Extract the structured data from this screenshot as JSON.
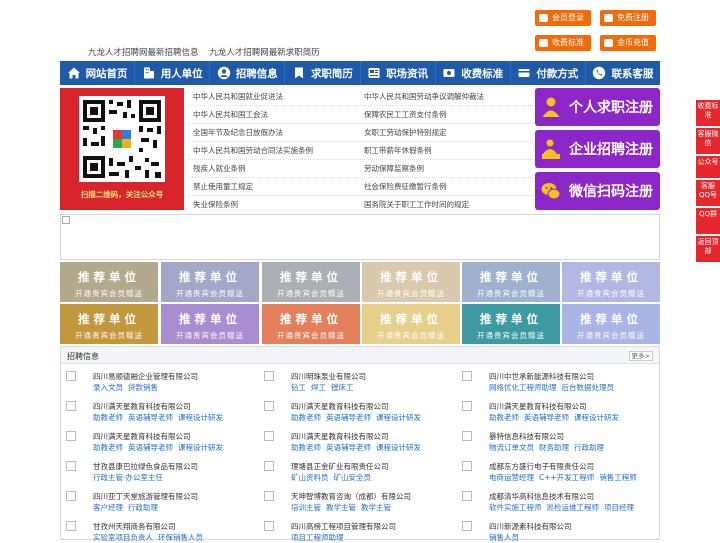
{
  "top_buttons": {
    "login": "会员登录",
    "register": "免费注册",
    "fees": "收费标准",
    "recharge": "金币充值"
  },
  "top_links": [
    "九龙人才招聘网最新招聘信息",
    "九龙人才招聘网最新求职简历"
  ],
  "nav": [
    {
      "label": "网站首页",
      "icon": "home-icon"
    },
    {
      "label": "用人单位",
      "icon": "building-icon"
    },
    {
      "label": "招聘信息",
      "icon": "user-icon"
    },
    {
      "label": "求职简历",
      "icon": "bookmark-icon"
    },
    {
      "label": "职场资讯",
      "icon": "news-icon"
    },
    {
      "label": "收费标准",
      "icon": "money-icon"
    },
    {
      "label": "付款方式",
      "icon": "card-icon"
    },
    {
      "label": "联系客服",
      "icon": "phone-icon"
    }
  ],
  "qr_caption": "扫描二维码，关注公众号",
  "laws_left": [
    "中华人民共和国就业促进法",
    "中华人民共和国工会法",
    "全国年节及纪念日放假办法",
    "中华人民共和国劳动合同法实施条例",
    "残疾人就业条例",
    "禁止使用童工规定",
    "失业保险条例"
  ],
  "laws_right": [
    "中华人民共和国劳动争议调解仲裁法",
    "保障农民工工资支付条例",
    "女职工劳动保护特别规定",
    "职工带薪年休假条例",
    "劳动保障监察条例",
    "社会保险费征缴暂行条例",
    "国务院关于职工工作时间的规定"
  ],
  "register_buttons": [
    "个人求职注册",
    "企业招聘注册",
    "微信扫码注册"
  ],
  "tiles": {
    "title": "推荐单位",
    "subtitle": "开通贵宾会员赠送",
    "row1_colors": [
      "#b3a98c",
      "#a4a8c8",
      "#aab0b5",
      "#d9c9ad",
      "#9fb1ce",
      "#b3b8e3"
    ],
    "row2_colors": [
      "#c3973c",
      "#a98dd1",
      "#e37f5a",
      "#e7cf8c",
      "#3d9aa2",
      "#a9b6e5"
    ]
  },
  "recruit": {
    "title": "招聘信息",
    "more": "更多>",
    "columns": [
      [
        {
          "company": "四川易顺德融企业管理有限公司",
          "positions": [
            "录入文员",
            "贷款销售"
          ]
        },
        {
          "company": "四川满天星教育科技有限公司",
          "positions": [
            "助教老师",
            "英语辅导老师",
            "课程设计研发"
          ]
        },
        {
          "company": "四川满天星教育科技有限公司",
          "positions": [
            "助教老师",
            "英语辅导老师",
            "课程设计研发"
          ]
        },
        {
          "company": "甘孜县康巴拉绿色食品有限公司",
          "positions": [
            "行政主管·办公室主任"
          ]
        },
        {
          "company": "四川亚丁天堂旅游管理有限公司",
          "positions": [
            "客户经理",
            "行政助理"
          ]
        },
        {
          "company": "甘孜州天翔商务有限公司",
          "positions": [
            "实验室项目负责人",
            "环保销售人员"
          ]
        }
      ],
      [
        {
          "company": "四川明珠泵业有限公司",
          "positions": [
            "钻工",
            "焊工",
            "镗床工"
          ]
        },
        {
          "company": "四川满天星教育科技有限公司",
          "positions": [
            "助教老师",
            "英语辅导老师",
            "课程设计研发"
          ]
        },
        {
          "company": "四川满天星教育科技有限公司",
          "positions": [
            "助教老师",
            "英语辅导老师",
            "课程设计研发"
          ]
        },
        {
          "company": "理塘县正金矿业有限责任公司",
          "positions": [
            "矿山资料员",
            "矿山安全员"
          ]
        },
        {
          "company": "天坤智博教育咨询（成都）有限公司",
          "positions": [
            "培训主管",
            "教学主管",
            "教学主管"
          ]
        },
        {
          "company": "四川高榜工程项目管理有限公司",
          "positions": [
            "项目工程师助理"
          ]
        }
      ],
      [
        {
          "company": "四川中世承新能源科技有限公司",
          "positions": [
            "网络优化工程师助理",
            "后台数据处理员"
          ]
        },
        {
          "company": "四川满天星教育科技有限公司",
          "positions": [
            "助教老师",
            "英语辅导老师",
            "课程设计研发"
          ]
        },
        {
          "company": "暴特信息科技有限公司",
          "positions": [
            "物流订单文员",
            "财务助理",
            "行政助理"
          ]
        },
        {
          "company": "成都东方盛行电子有限责任公司",
          "positions": [
            "电商运营经理",
            "C++开发工程师",
            "销售工程师"
          ]
        },
        {
          "company": "成都清华高科信息技术有限公司",
          "positions": [
            "软件实施工程师",
            "巡检运维工程师",
            "项目经理"
          ]
        },
        {
          "company": "四川新源素科技有限公司",
          "positions": [
            "销售人员"
          ]
        }
      ]
    ]
  },
  "side_bar": [
    "收费标准",
    "客服微信",
    "公众号",
    "客服QQ号",
    "QQ群",
    "返回顶部"
  ],
  "colors": {
    "nav": "#1e5aa8",
    "orange": "#f26b0a",
    "purple": "#8d26c8",
    "red": "#d8242b",
    "link": "#1f6fd0"
  }
}
